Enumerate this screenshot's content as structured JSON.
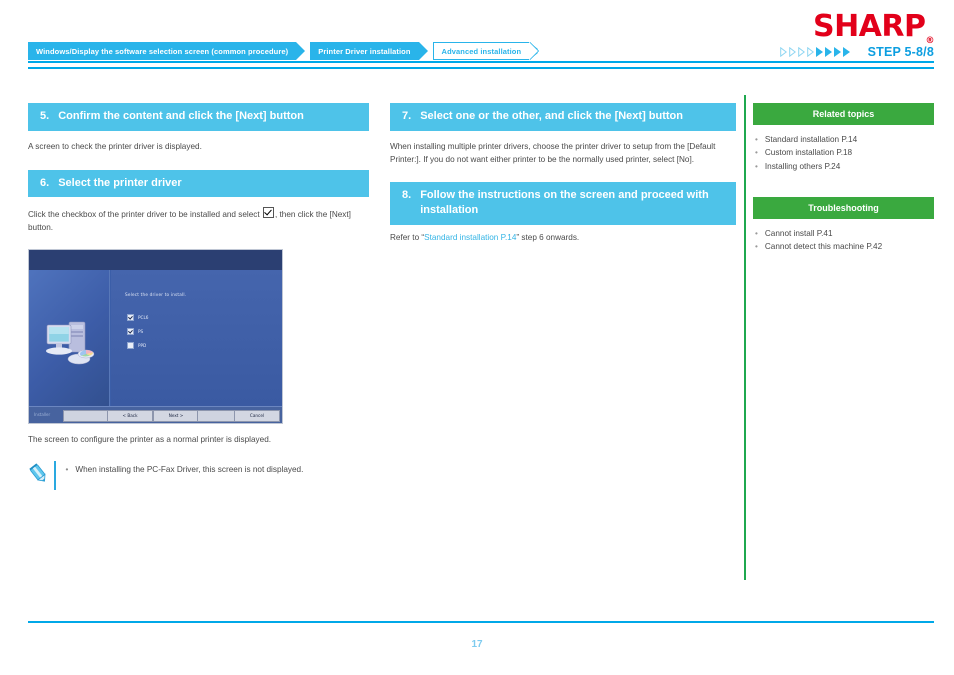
{
  "header": {
    "logo_text": "SHARP",
    "logo_reg": "®",
    "breadcrumbs": [
      {
        "label": "Windows/Display the software selection screen (common procedure)",
        "state": "filled"
      },
      {
        "label": "Printer Driver installation",
        "state": "filled"
      },
      {
        "label": "Advanced installation",
        "state": "outline"
      }
    ],
    "step_label": "STEP  5-8/8",
    "step_progress": {
      "hollow": 4,
      "filled": 4
    }
  },
  "left_column": {
    "step5": {
      "number": "5.",
      "title": "Confirm the content and click the [Next] button",
      "body": "A screen to check the printer driver is displayed."
    },
    "step6": {
      "number": "6.",
      "title": "Select the printer driver",
      "body_before": "Click the checkbox of the printer driver to be installed and select",
      "body_after": ", then click the [Next] button."
    },
    "installer": {
      "prompt": "Select the driver to install.",
      "options": [
        {
          "label": "PCL6",
          "checked": true
        },
        {
          "label": "PS",
          "checked": true
        },
        {
          "label": "PPD",
          "checked": false
        }
      ],
      "brand": "Installer",
      "buttons": {
        "back": "< Back",
        "next": "Next >",
        "cancel": "Cancel"
      }
    },
    "caption": "The screen to configure the printer as a normal printer is displayed.",
    "note": {
      "bullet": "•",
      "text": "When installing the PC-Fax Driver, this screen is not displayed."
    }
  },
  "mid_column": {
    "step7": {
      "number": "7.",
      "title": "Select one or the other, and click the [Next] button",
      "body": "When installing multiple printer drivers, choose the printer driver to setup from the [Default Printer:]. If you do not want either printer to be the normally used printer, select [No]."
    },
    "step8": {
      "number": "8.",
      "title": "Follow the instructions on the screen and proceed with installation",
      "body_before": "Refer to “",
      "body_link": "Standard installation P.14",
      "body_after": "” step 6 onwards."
    }
  },
  "right_column": {
    "related_heading": "Related topics",
    "related_items": [
      "Standard installation P.14",
      "Custom installation P.18",
      "Installing others P.24"
    ],
    "troubleshooting_heading": "Troubleshooting",
    "troubleshooting_items": [
      "Cannot install P.41",
      "Cannot detect this machine P.42"
    ],
    "bullet": "•"
  },
  "footer": {
    "page_number": "17"
  },
  "colors": {
    "brand_red": "#e2001a",
    "accent_blue": "#00a8e8",
    "heading_blue": "#4ec3e9",
    "crumb_blue": "#29b4ea",
    "green": "#3aa93f",
    "divider_green": "#1fa84f",
    "link_blue": "#33b4e5"
  }
}
